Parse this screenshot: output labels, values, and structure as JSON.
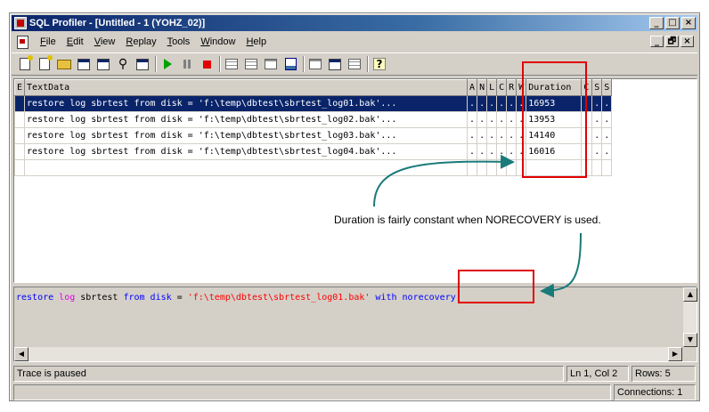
{
  "window": {
    "title": "SQL Profiler - [Untitled - 1 (YOHZ_02)]",
    "caption_buttons": [
      "_",
      "□",
      "×"
    ],
    "mdi_buttons": [
      "_",
      "🗗",
      "×"
    ]
  },
  "menu": [
    {
      "pre": "",
      "ul": "F",
      "post": "ile"
    },
    {
      "pre": "",
      "ul": "E",
      "post": "dit"
    },
    {
      "pre": "",
      "ul": "V",
      "post": "iew"
    },
    {
      "pre": "",
      "ul": "R",
      "post": "eplay"
    },
    {
      "pre": "",
      "ul": "T",
      "post": "ools"
    },
    {
      "pre": "",
      "ul": "W",
      "post": "indow"
    },
    {
      "pre": "",
      "ul": "H",
      "post": "elp"
    }
  ],
  "toolbar_icons": [
    "new-trace-icon",
    "new-template-icon",
    "open-icon",
    "properties-icon",
    "edit-template-icon",
    "find-icon",
    "replay-icon",
    "run-icon",
    "pause-icon",
    "stop-icon",
    "grid-icon",
    "split-icon",
    "pane-icon",
    "trace-icon",
    "sql-icon",
    "tools-icon",
    "templates-icon",
    "help-icon"
  ],
  "grid": {
    "columns": [
      "E",
      "TextData",
      "A",
      "N",
      "L",
      "C",
      "R",
      "W",
      "Duration",
      "C",
      "S",
      "S"
    ],
    "rows": [
      {
        "text": "restore log sbrtest from disk = 'f:\\temp\\dbtest\\sbrtest_log01.bak'...",
        "duration": "16953",
        "selected": true
      },
      {
        "text": "restore log sbrtest from disk = 'f:\\temp\\dbtest\\sbrtest_log02.bak'...",
        "duration": "13953",
        "selected": false
      },
      {
        "text": "restore log sbrtest from disk = 'f:\\temp\\dbtest\\sbrtest_log03.bak'...",
        "duration": "14140",
        "selected": false
      },
      {
        "text": "restore log sbrtest from disk = 'f:\\temp\\dbtest\\sbrtest_log04.bak'...",
        "duration": "16016",
        "selected": false
      }
    ],
    "dot": "."
  },
  "text_pane": {
    "tokens": [
      {
        "t": "restore ",
        "c": "kw"
      },
      {
        "t": "log ",
        "c": "kw2"
      },
      {
        "t": "sbrtest ",
        "c": ""
      },
      {
        "t": "from ",
        "c": "kw"
      },
      {
        "t": "disk ",
        "c": "kw"
      },
      {
        "t": "= ",
        "c": ""
      },
      {
        "t": "'f:\\temp\\dbtest\\sbrtest_log01.bak' ",
        "c": "str"
      },
      {
        "t": "with ",
        "c": "kw"
      },
      {
        "t": "norecovery",
        "c": "kw"
      }
    ]
  },
  "annotation": "Duration is fairly constant when NORECOVERY is used.",
  "status": {
    "message": "Trace is paused",
    "position": "Ln 1, Col 2",
    "rows": "Rows: 5",
    "connections": "Connections: 1"
  },
  "colors": {
    "selection": "#0a246a",
    "highlight_box": "#e00000",
    "arrow": "#1a7a7a"
  }
}
